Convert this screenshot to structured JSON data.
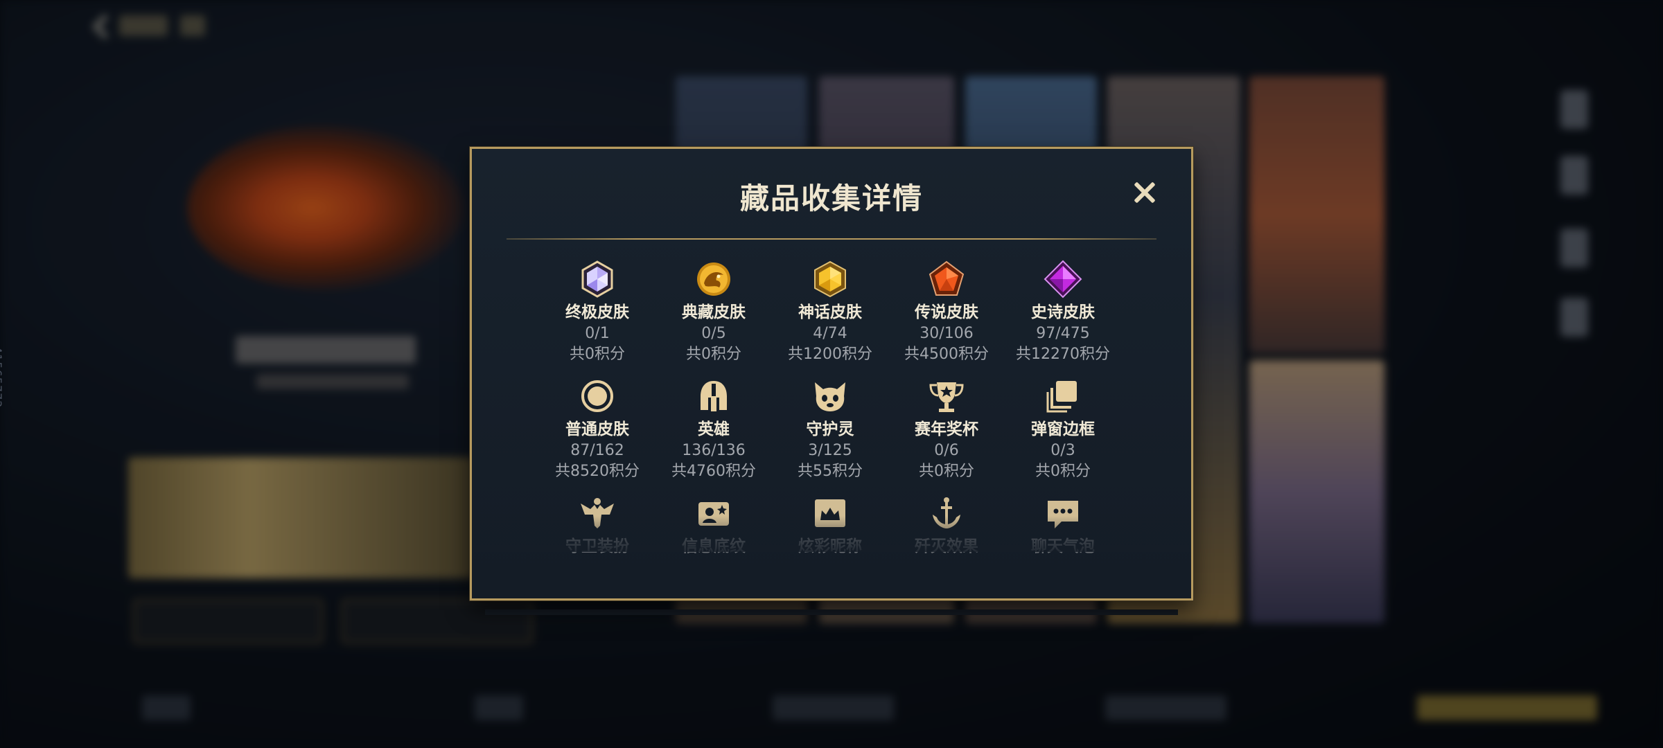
{
  "background": {
    "side_id": "41565772"
  },
  "modal": {
    "title": "藏品收集详情",
    "close_icon": "close-icon",
    "items": [
      {
        "name": "终极皮肤",
        "count": "0/1",
        "points": "共0积分",
        "icon": "ultimate-skin-gem-icon"
      },
      {
        "name": "典藏皮肤",
        "count": "0/5",
        "points": "共0积分",
        "icon": "collection-skin-dragon-icon"
      },
      {
        "name": "神话皮肤",
        "count": "4/74",
        "points": "共1200积分",
        "icon": "mythic-skin-gem-icon"
      },
      {
        "name": "传说皮肤",
        "count": "30/106",
        "points": "共4500积分",
        "icon": "legendary-skin-gem-icon"
      },
      {
        "name": "史诗皮肤",
        "count": "97/475",
        "points": "共12270积分",
        "icon": "epic-skin-gem-icon"
      },
      {
        "name": "普通皮肤",
        "count": "87/162",
        "points": "共8520积分",
        "icon": "normal-skin-ring-icon"
      },
      {
        "name": "英雄",
        "count": "136/136",
        "points": "共4760积分",
        "icon": "hero-helmet-icon"
      },
      {
        "name": "守护灵",
        "count": "3/125",
        "points": "共55积分",
        "icon": "guardian-spirit-icon"
      },
      {
        "name": "赛年奖杯",
        "count": "0/6",
        "points": "共0积分",
        "icon": "trophy-icon"
      },
      {
        "name": "弹窗边框",
        "count": "0/3",
        "points": "共0积分",
        "icon": "popup-frame-icon"
      },
      {
        "name": "守卫装扮",
        "icon": "guard-outfit-icon"
      },
      {
        "name": "信息底纹",
        "icon": "info-background-icon"
      },
      {
        "name": "炫彩昵称",
        "icon": "colorful-nickname-icon"
      },
      {
        "name": "歼灭效果",
        "icon": "elimination-effect-icon"
      },
      {
        "name": "聊天气泡",
        "icon": "chat-bubble-icon"
      }
    ]
  },
  "colors": {
    "modal_border": "#b79b5f",
    "title_text": "#efe6cf",
    "secondary_text": "#a3a7ad",
    "icon_gold": "#e6cfa0"
  }
}
